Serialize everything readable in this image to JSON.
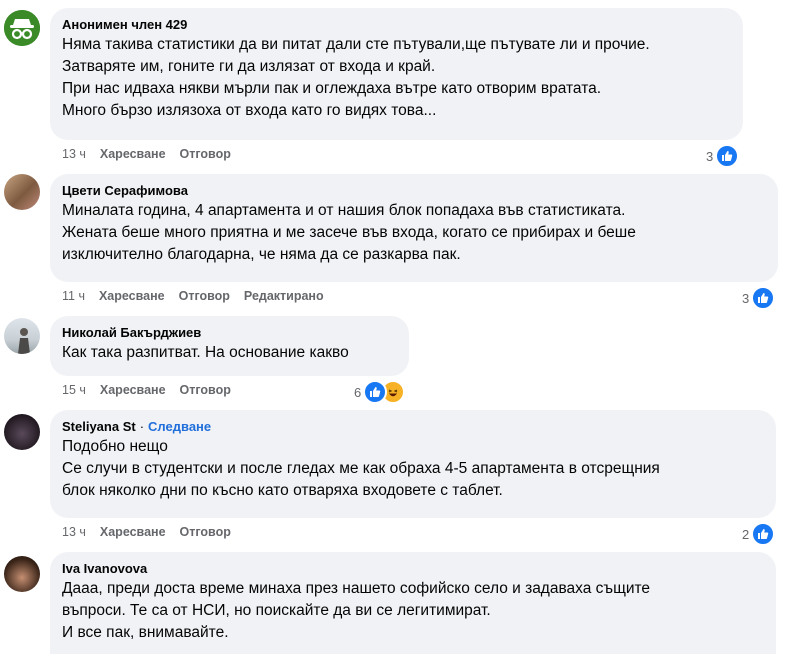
{
  "comments": [
    {
      "author": "Анонимен член 429",
      "lines": [
        "Няма такива статистики да ви питат дали сте пътували,ще пътувате ли и прочие.",
        "Затваряте им, гоните ги да излязат от входа и край.",
        "При нас идваха някви мърли пак и оглеждаха вътре като отворим вратата.",
        "Много бързо излязоха от входа като го видях това..."
      ],
      "time": "13 ч",
      "like_label": "Харесване",
      "reply_label": "Отговор",
      "reaction_count": "3"
    },
    {
      "author": "Цвети Серафимова",
      "lines": [
        "Миналата година, 4 апартамента и от нашия блок попадаха във статистиката.",
        "Жената беше много приятна и ме засече във входа, когато се прибирах и беше",
        "изключително благодарна, че няма да се разкарва пак."
      ],
      "time": "11 ч",
      "like_label": "Харесване",
      "reply_label": "Отговор",
      "edited_label": "Редактирано",
      "reaction_count": "3"
    },
    {
      "author": "Николай Бакърджиев",
      "lines": [
        "Как така разпитват. На основание какво"
      ],
      "time": "15 ч",
      "like_label": "Харесване",
      "reply_label": "Отговор",
      "reaction_count": "6"
    },
    {
      "author": "Steliyana St",
      "follow_label": "Следване",
      "lines": [
        "Подобно нещо",
        "Се случи в студентски и после гледах ме как обраха 4-5 апартамента в отсрещния",
        "блок няколко дни по късно като отваряха входовете с таблет."
      ],
      "time": "13 ч",
      "like_label": "Харесване",
      "reply_label": "Отговор",
      "reaction_count": "2"
    },
    {
      "author": "Iva Ivanovova",
      "lines": [
        "Дааа, преди доста време минаха през нашето софийско село и задаваха същите",
        "въпроси. Те са от НСИ, но поискайте да ви се легитимират.",
        "И все пак, внимавайте."
      ]
    }
  ],
  "colors": {
    "bubble": "#f0f2f5",
    "like_blue": "#1877f2",
    "follow_blue": "#216fdb",
    "meta_gray": "#65676b"
  }
}
